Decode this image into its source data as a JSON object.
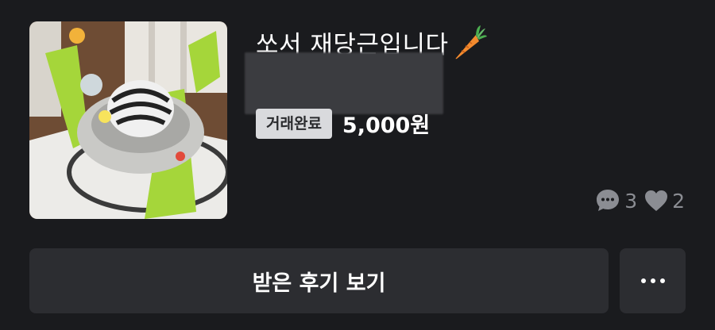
{
  "item": {
    "title": "쏘서 재당근입니다",
    "title_emoji": "carrot-icon",
    "status_badge": "거래완료",
    "price": "5,000원",
    "chat_count": "3",
    "like_count": "2",
    "thumbnail": "baby-jumper-photo"
  },
  "actions": {
    "review_label": "받은 후기 보기",
    "more_icon": "more-horizontal-icon"
  },
  "colors": {
    "background": "#1a1b1e",
    "button_bg": "#2c2d31",
    "badge_bg": "#d9dadd",
    "muted_text": "#8b8d93"
  }
}
